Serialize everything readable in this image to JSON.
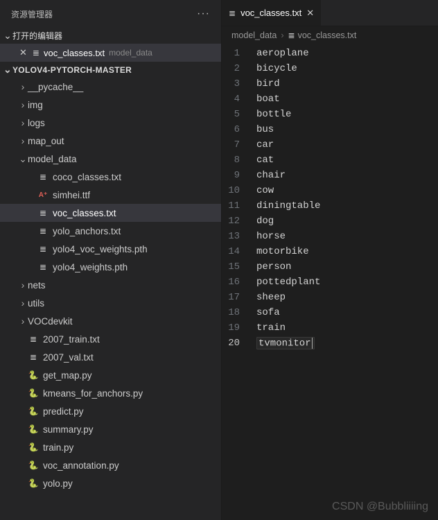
{
  "explorer": {
    "title": "资源管理器",
    "open_editors_label": "打开的编辑器",
    "open_editor": {
      "filename": "voc_classes.txt",
      "folder": "model_data"
    },
    "project_name": "YOLOV4-PYTORCH-MASTER",
    "tree": [
      {
        "type": "folder",
        "name": "__pycache__",
        "depth": 2,
        "open": false
      },
      {
        "type": "folder",
        "name": "img",
        "depth": 2,
        "open": false
      },
      {
        "type": "folder",
        "name": "logs",
        "depth": 2,
        "open": false
      },
      {
        "type": "folder",
        "name": "map_out",
        "depth": 2,
        "open": false
      },
      {
        "type": "folder",
        "name": "model_data",
        "depth": 2,
        "open": true
      },
      {
        "type": "file",
        "name": "coco_classes.txt",
        "depth": 3,
        "kind": "txt"
      },
      {
        "type": "file",
        "name": "simhei.ttf",
        "depth": 3,
        "kind": "font"
      },
      {
        "type": "file",
        "name": "voc_classes.txt",
        "depth": 3,
        "kind": "txt",
        "selected": true
      },
      {
        "type": "file",
        "name": "yolo_anchors.txt",
        "depth": 3,
        "kind": "txt"
      },
      {
        "type": "file",
        "name": "yolo4_voc_weights.pth",
        "depth": 3,
        "kind": "txt"
      },
      {
        "type": "file",
        "name": "yolo4_weights.pth",
        "depth": 3,
        "kind": "txt"
      },
      {
        "type": "folder",
        "name": "nets",
        "depth": 2,
        "open": false
      },
      {
        "type": "folder",
        "name": "utils",
        "depth": 2,
        "open": false
      },
      {
        "type": "folder",
        "name": "VOCdevkit",
        "depth": 2,
        "open": false
      },
      {
        "type": "file",
        "name": "2007_train.txt",
        "depth": 2,
        "kind": "txt"
      },
      {
        "type": "file",
        "name": "2007_val.txt",
        "depth": 2,
        "kind": "txt"
      },
      {
        "type": "file",
        "name": "get_map.py",
        "depth": 2,
        "kind": "py"
      },
      {
        "type": "file",
        "name": "kmeans_for_anchors.py",
        "depth": 2,
        "kind": "py"
      },
      {
        "type": "file",
        "name": "predict.py",
        "depth": 2,
        "kind": "py"
      },
      {
        "type": "file",
        "name": "summary.py",
        "depth": 2,
        "kind": "py"
      },
      {
        "type": "file",
        "name": "train.py",
        "depth": 2,
        "kind": "py"
      },
      {
        "type": "file",
        "name": "voc_annotation.py",
        "depth": 2,
        "kind": "py"
      },
      {
        "type": "file",
        "name": "yolo.py",
        "depth": 2,
        "kind": "py"
      }
    ]
  },
  "tab": {
    "filename": "voc_classes.txt"
  },
  "breadcrumbs": {
    "folder": "model_data",
    "file": "voc_classes.txt"
  },
  "editor_lines": [
    "aeroplane",
    "bicycle",
    "bird",
    "boat",
    "bottle",
    "bus",
    "car",
    "cat",
    "chair",
    "cow",
    "diningtable",
    "dog",
    "horse",
    "motorbike",
    "person",
    "pottedplant",
    "sheep",
    "sofa",
    "train",
    "tvmonitor"
  ],
  "current_line": 20,
  "watermark": "CSDN @Bubbliiiing"
}
